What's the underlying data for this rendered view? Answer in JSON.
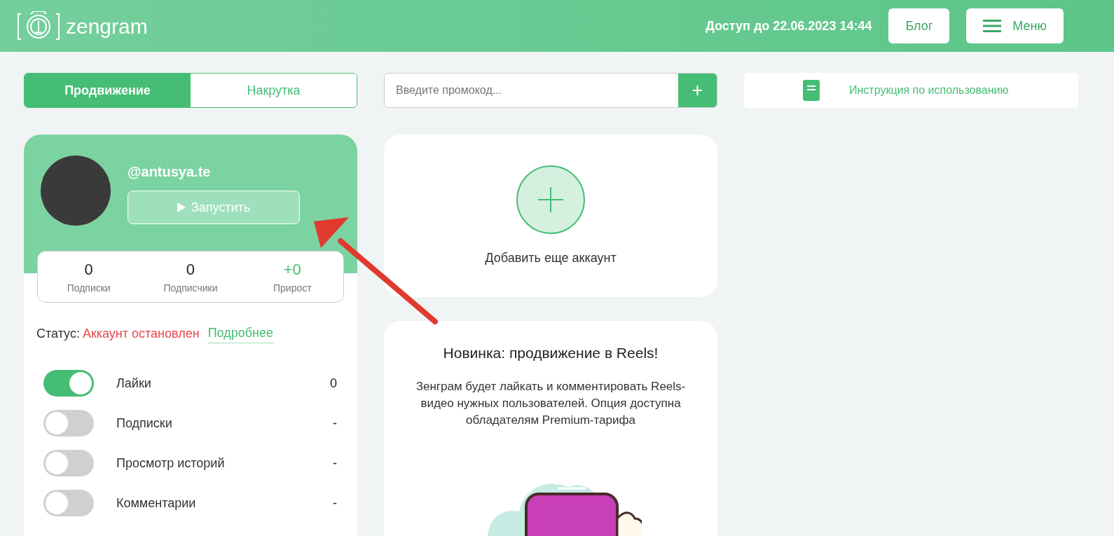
{
  "header": {
    "logo": "zengram",
    "access": "Доступ до 22.06.2023 14:44",
    "blog_button": "Блог",
    "menu_button": "Меню"
  },
  "tabs": [
    {
      "label": "Продвижение",
      "selected": true
    },
    {
      "label": "Накрутка",
      "selected": false
    }
  ],
  "promo": {
    "placeholder": "Введите промокод...",
    "add_button": "+"
  },
  "instructions": "Инструкция по использованию",
  "account": {
    "username": "@antusya.te",
    "start_button": "Запустить",
    "stats": [
      {
        "value": "0",
        "label": "Подписки",
        "kind": "plain"
      },
      {
        "value": "0",
        "label": "Подписчики",
        "kind": "plain"
      },
      {
        "value": "+0",
        "label": "Прирост",
        "kind": "growth"
      }
    ],
    "status_label": "Статус:",
    "status_value": "Аккаунт остановлен",
    "details_link": "Подробнее",
    "options": [
      {
        "label": "Лайки",
        "on": true,
        "count": "0"
      },
      {
        "label": "Подписки",
        "on": false,
        "count": "-"
      },
      {
        "label": "Просмотр историй",
        "on": false,
        "count": "-"
      },
      {
        "label": "Комментарии",
        "on": false,
        "count": "-"
      }
    ]
  },
  "add_account": {
    "label": "Добавить еще аккаунт"
  },
  "news": {
    "title": "Новинка: продвижение в Reels!",
    "text": "Зенграм будет лайкать и комментировать Reels-видео нужных пользователей. Опция доступна обладателям Premium-тарифа"
  }
}
